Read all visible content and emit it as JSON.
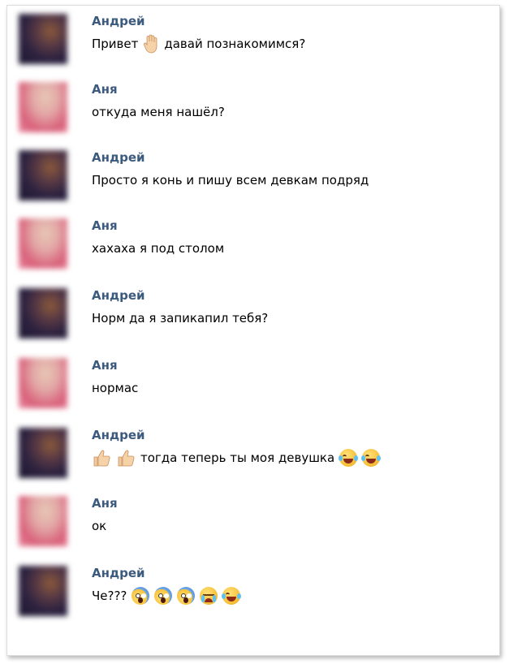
{
  "conversation": {
    "messages": [
      {
        "author": "Андрей",
        "avatar": "andrey-avatar",
        "segments": [
          {
            "t": "Привет"
          },
          {
            "icon": "raised-hand-icon"
          },
          {
            "t": "давай познакомимся?"
          }
        ]
      },
      {
        "author": "Аня",
        "avatar": "anya-avatar",
        "segments": [
          {
            "t": "откуда меня нашёл?"
          }
        ]
      },
      {
        "author": "Андрей",
        "avatar": "andrey-avatar",
        "segments": [
          {
            "t": "Просто я конь и пишу всем девкам подряд"
          }
        ]
      },
      {
        "author": "Аня",
        "avatar": "anya-avatar",
        "segments": [
          {
            "t": "хахаха я под столом"
          }
        ]
      },
      {
        "author": "Андрей",
        "avatar": "andrey-avatar",
        "segments": [
          {
            "t": "Норм да я запикапил тебя?"
          }
        ]
      },
      {
        "author": "Аня",
        "avatar": "anya-avatar",
        "segments": [
          {
            "t": "нормас"
          }
        ]
      },
      {
        "author": "Андрей",
        "avatar": "andrey-avatar",
        "segments": [
          {
            "icon": "thumbs-up-icon"
          },
          {
            "icon": "thumbs-up-icon"
          },
          {
            "t": "тогда теперь ты моя девушка"
          },
          {
            "icon": "tears-of-joy-emoji-icon"
          },
          {
            "icon": "tears-of-joy-emoji-icon"
          }
        ]
      },
      {
        "author": "Аня",
        "avatar": "anya-avatar",
        "segments": [
          {
            "t": "ок"
          }
        ]
      },
      {
        "author": "Андрей",
        "avatar": "andrey-avatar",
        "segments": [
          {
            "t": "Че???"
          },
          {
            "icon": "screaming-face-emoji-icon"
          },
          {
            "icon": "screaming-face-emoji-icon"
          },
          {
            "icon": "screaming-face-emoji-icon"
          },
          {
            "icon": "crying-face-emoji-icon"
          },
          {
            "icon": "tears-of-joy-emoji-icon"
          }
        ]
      }
    ]
  },
  "colors": {
    "author_name": "#3b5a7e",
    "message_text": "#000000",
    "background": "#ffffff"
  }
}
